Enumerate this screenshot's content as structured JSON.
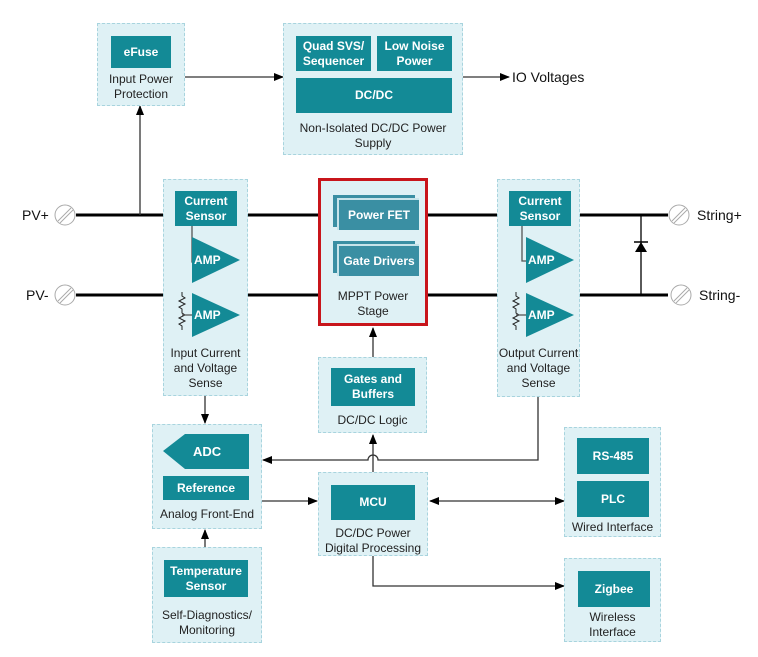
{
  "colors": {
    "block_fill": "#138a96",
    "group_fill": "#dff1f5",
    "group_border": "#a8d4de",
    "highlight_border": "#c8151b",
    "wire": "#000000"
  },
  "terminals": {
    "pv_plus": "PV+",
    "pv_minus": "PV-",
    "string_plus": "String+",
    "string_minus": "String-",
    "io_voltages": "IO Voltages"
  },
  "groups": {
    "input_protection": {
      "caption": "Input Power Protection",
      "blocks": [
        "eFuse"
      ]
    },
    "dcdc_supply": {
      "caption": "Non-Isolated DC/DC Power Supply",
      "blocks": [
        "Quad SVS/ Sequencer",
        "Low Noise Power",
        "DC/DC"
      ]
    },
    "input_sense": {
      "caption": "Input Current and Voltage Sense",
      "blocks": [
        "Current Sensor",
        "AMP",
        "AMP"
      ]
    },
    "mppt_stage": {
      "caption": "MPPT Power Stage",
      "blocks": [
        "Power FET",
        "Gate Drivers"
      ]
    },
    "output_sense": {
      "caption": "Output Current and Voltage Sense",
      "blocks": [
        "Current Sensor",
        "AMP",
        "AMP"
      ]
    },
    "dcdc_logic": {
      "caption": "DC/DC Logic",
      "blocks": [
        "Gates and Buffers"
      ]
    },
    "analog_front_end": {
      "caption": "Analog Front-End",
      "blocks": [
        "ADC",
        "Reference"
      ]
    },
    "digital_processing": {
      "caption": "DC/DC Power Digital Processing",
      "blocks": [
        "MCU"
      ]
    },
    "wired_interface": {
      "caption": "Wired Interface",
      "blocks": [
        "RS-485",
        "PLC"
      ]
    },
    "self_diagnostics": {
      "caption": "Self-Diagnostics/ Monitoring",
      "blocks": [
        "Temperature Sensor"
      ]
    },
    "wireless_interface": {
      "caption": "Wireless Interface",
      "blocks": [
        "Zigbee"
      ]
    }
  }
}
